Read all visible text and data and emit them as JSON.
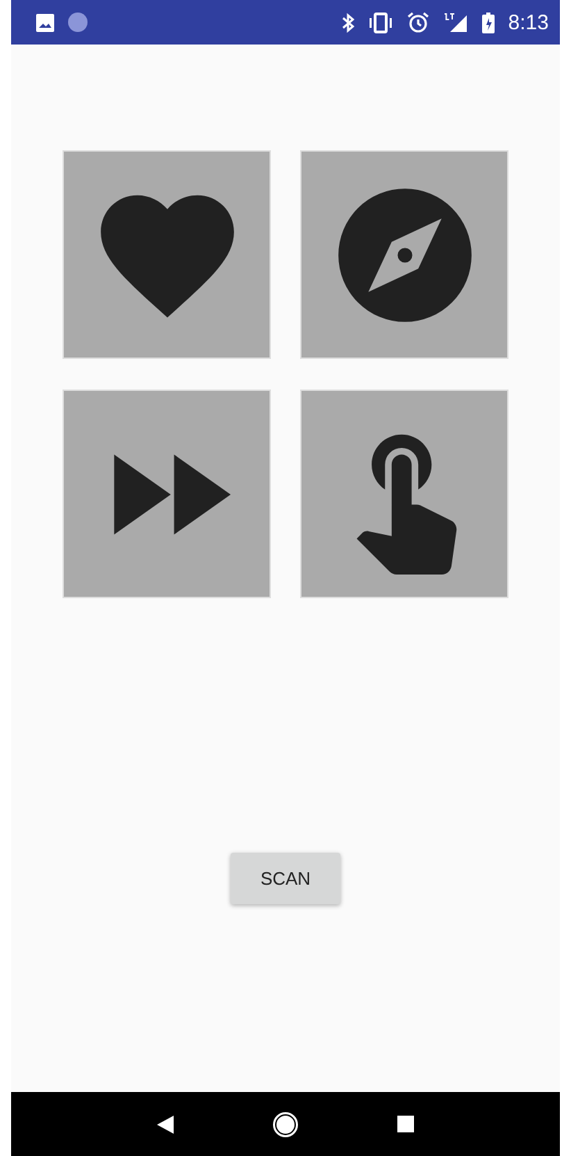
{
  "status_bar": {
    "time": "8:13"
  },
  "tiles": [
    {
      "kind": "heart"
    },
    {
      "kind": "compass"
    },
    {
      "kind": "fast-forward"
    },
    {
      "kind": "touch"
    }
  ],
  "scan_button": {
    "label": "SCAN"
  }
}
